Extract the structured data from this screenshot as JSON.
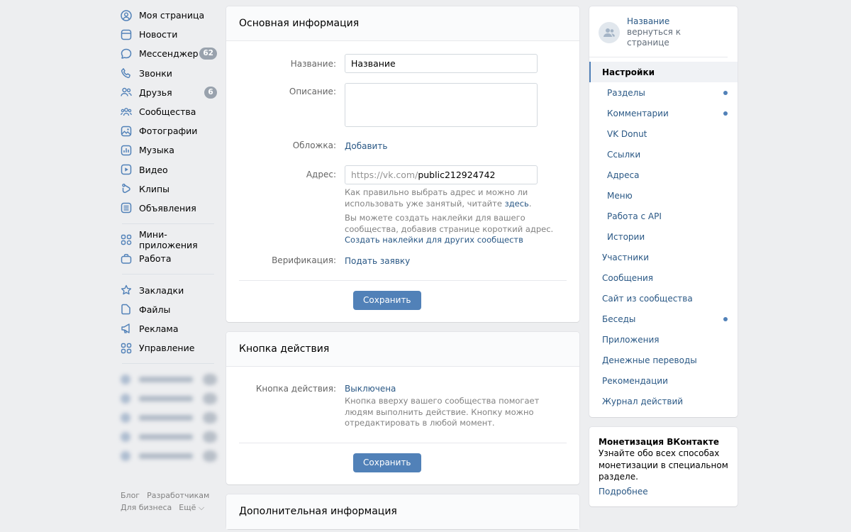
{
  "left_nav": {
    "items": [
      {
        "label": "Моя страница",
        "icon": "user-circle-icon"
      },
      {
        "label": "Новости",
        "icon": "news-icon"
      },
      {
        "label": "Мессенджер",
        "icon": "message-icon",
        "badge": "62"
      },
      {
        "label": "Звонки",
        "icon": "phone-icon"
      },
      {
        "label": "Друзья",
        "icon": "friends-icon",
        "badge": "6"
      },
      {
        "label": "Сообщества",
        "icon": "communities-icon"
      },
      {
        "label": "Фотографии",
        "icon": "photo-icon"
      },
      {
        "label": "Музыка",
        "icon": "music-icon"
      },
      {
        "label": "Видео",
        "icon": "video-icon"
      },
      {
        "label": "Клипы",
        "icon": "clips-icon"
      },
      {
        "label": "Объявления",
        "icon": "ads-board-icon"
      }
    ],
    "items2": [
      {
        "label": "Мини-приложения",
        "icon": "apps-icon"
      },
      {
        "label": "Работа",
        "icon": "briefcase-icon"
      }
    ],
    "items3": [
      {
        "label": "Закладки",
        "icon": "star-icon"
      },
      {
        "label": "Файлы",
        "icon": "file-icon"
      },
      {
        "label": "Реклама",
        "icon": "megaphone-icon"
      },
      {
        "label": "Управление",
        "icon": "manage-grid-icon"
      }
    ],
    "footer": {
      "blog": "Блог",
      "dev": "Разработчикам",
      "business": "Для бизнеса",
      "more": "Ещё ⌵"
    }
  },
  "basic_info": {
    "header": "Основная информация",
    "name_label": "Название:",
    "name_value": "Название",
    "description_label": "Описание:",
    "cover_label": "Обложка:",
    "cover_action": "Добавить",
    "address_label": "Адрес:",
    "address_prefix": "https://vk.com/",
    "address_value": "public212924742",
    "hint1": "Как правильно выбрать адрес и можно ли использовать уже занятый, читайте",
    "hint1_link": "здесь",
    "hint2": "Вы можете создать наклейки для вашего сообщества, добавив странице короткий адрес.",
    "hint2_link": "Создать наклейки для других сообществ",
    "verification_label": "Верификация:",
    "verification_action": "Подать заявку",
    "save": "Сохранить"
  },
  "action_button": {
    "header": "Кнопка действия",
    "label": "Кнопка действия:",
    "value": "Выключена",
    "hint": "Кнопка вверху вашего сообщества помогает людям выполнить действие. Кнопку можно отредактировать в любой момент.",
    "save": "Сохранить"
  },
  "extra_info": {
    "header": "Дополнительная информация"
  },
  "right": {
    "back_title": "Название",
    "back_sub": "вернуться к странице",
    "menu": [
      {
        "label": "Настройки",
        "active": true
      },
      {
        "label": "Разделы",
        "sub": true,
        "dot": true
      },
      {
        "label": "Комментарии",
        "sub": true,
        "dot": true
      },
      {
        "label": "VK Donut",
        "sub": true
      },
      {
        "label": "Ссылки",
        "sub": true
      },
      {
        "label": "Адреса",
        "sub": true
      },
      {
        "label": "Меню",
        "sub": true
      },
      {
        "label": "Работа с API",
        "sub": true
      },
      {
        "label": "Истории",
        "sub": true
      },
      {
        "label": "Участники"
      },
      {
        "label": "Сообщения"
      },
      {
        "label": "Сайт из сообщества"
      },
      {
        "label": "Беседы",
        "dot": true
      },
      {
        "label": "Приложения"
      },
      {
        "label": "Денежные переводы"
      },
      {
        "label": "Рекомендации"
      },
      {
        "label": "Журнал действий"
      }
    ],
    "promo": {
      "title": "Монетизация ВКонтакте",
      "text": "Узнайте обо всех способах монетизации в специальном разделе.",
      "link": "Подробнее"
    }
  },
  "colors": {
    "accent": "#5181b8",
    "link": "#2a5885",
    "background": "#edeef0",
    "icon": "#5181b8"
  }
}
